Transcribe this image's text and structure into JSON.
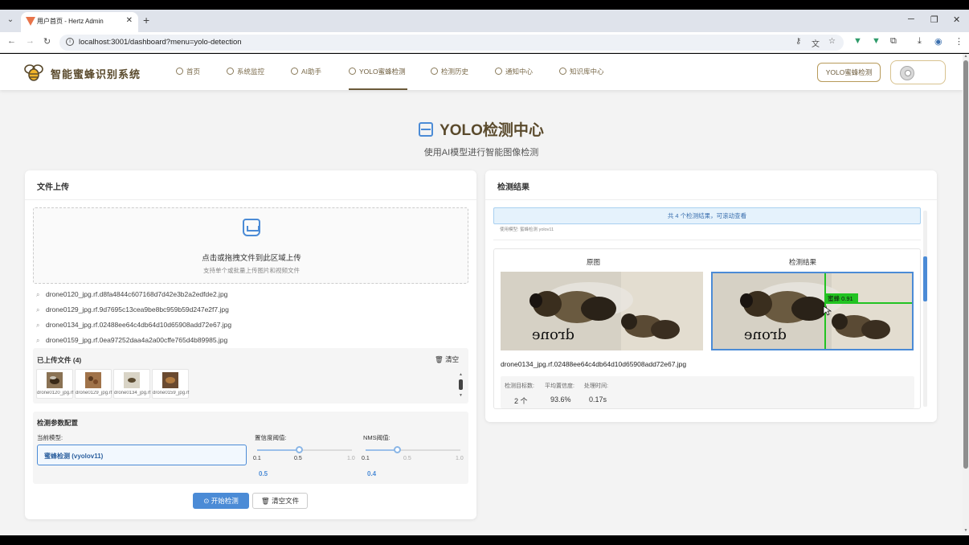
{
  "browser": {
    "tab_title": "用户首页 - Hertz Admin",
    "url": "localhost:3001/dashboard?menu=yolo-detection"
  },
  "header": {
    "brand": "智能蜜蜂识别系统",
    "nav": [
      {
        "label": "首页"
      },
      {
        "label": "系统监控"
      },
      {
        "label": "AI助手"
      },
      {
        "label": "YOLO蜜蜂检测"
      },
      {
        "label": "检测历史"
      },
      {
        "label": "通知中心"
      },
      {
        "label": "知识库中心"
      }
    ],
    "action_button": "YOLO蜜蜂检测"
  },
  "page": {
    "title": "YOLO检测中心",
    "subtitle": "使用AI模型进行智能图像检测"
  },
  "upload": {
    "card_title": "文件上传",
    "drop_text": "点击或拖拽文件到此区域上传",
    "drop_hint": "支持单个或批量上传图片和视频文件",
    "files": [
      "drone0120_jpg.rf.d8fa4844c607168d7d42e3b2a2edfde2.jpg",
      "drone0129_jpg.rf.9d7695c13cea9be8bc959b59d247e2f7.jpg",
      "drone0134_jpg.rf.02488ee64c4db64d10d65908add72e67.jpg",
      "drone0159_jpg.rf.0ea97252daa4a2a00cffe765d4b89985.jpg"
    ],
    "uploaded_title": "已上传文件 (4)",
    "clear_label": "清空",
    "thumbs": [
      "drone0120_jpg.rf.d8",
      "drone0129_jpg.rf.9d",
      "drone0134_jpg.rf.02",
      "drone0159_jpg.rf.0e"
    ]
  },
  "config": {
    "title": "检测参数配置",
    "model_label": "当前模型:",
    "model_value": "蜜蜂检测 (vyolov11)",
    "confidence": {
      "label": "置信度阈值:",
      "min": "0.1",
      "mid": "0.5",
      "max": "1.0",
      "value": 0.5,
      "display": "0.5"
    },
    "nms": {
      "label": "NMS阈值:",
      "min": "0.1",
      "mid": "0.5",
      "max": "1.0",
      "value": 0.4,
      "display": "0.4"
    },
    "start_button": "开始检测",
    "clear_button": "清空文件"
  },
  "result": {
    "card_title": "检测结果",
    "banner": "共 4 个检测结果，可滚动查看",
    "model_note": "使用模型: 蜜蜂检测 yolov11",
    "col_original": "原图",
    "col_result": "检测结果",
    "file_name": "drone0134_jpg.rf.02488ee64c4db64d10d65908add72e67.jpg",
    "image_watermark": "drone",
    "box_label": "蜜蜂 0.91",
    "stats": [
      {
        "label": "检测目标数:",
        "value": "2 个"
      },
      {
        "label": "平均置信度:",
        "value": "93.6%"
      },
      {
        "label": "处理时间:",
        "value": "0.17s"
      }
    ]
  },
  "colors": {
    "accent": "#4b8bd6",
    "brand": "#5a4a2c",
    "box": "#22c322"
  }
}
